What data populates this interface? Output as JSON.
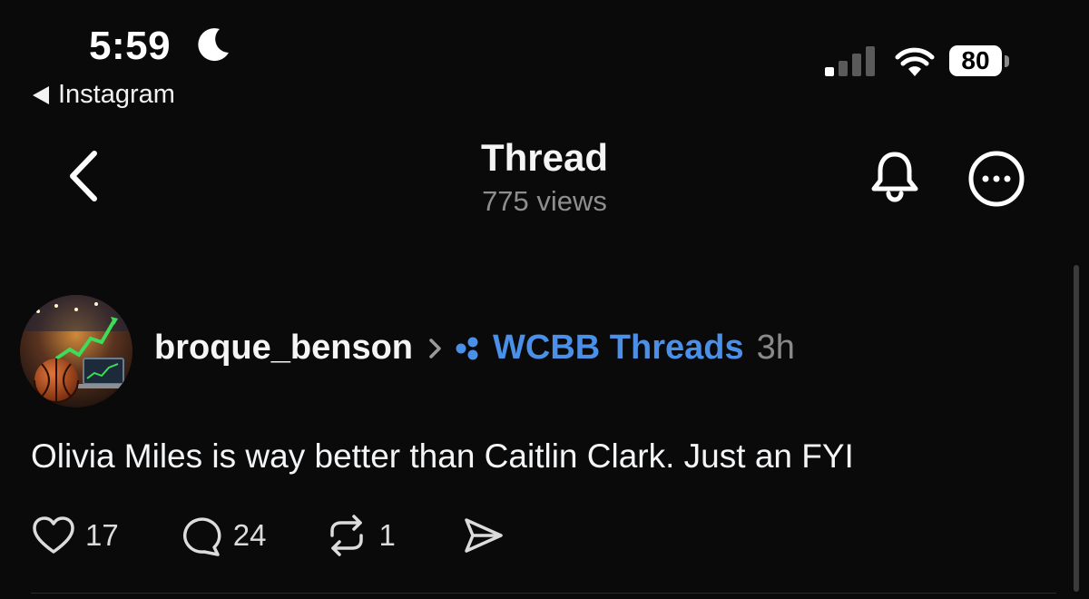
{
  "status_bar": {
    "time": "5:59",
    "back_app": "Instagram",
    "battery": "80"
  },
  "nav": {
    "title": "Thread",
    "views": "775 views"
  },
  "post": {
    "username": "broque_benson",
    "community": "WCBB Threads",
    "timestamp": "3h",
    "text": "Olivia Miles is way better than Caitlin Clark. Just an FYI",
    "likes": "17",
    "replies": "24",
    "reposts": "1"
  },
  "colors": {
    "background": "#0a0a0a",
    "community_link": "#4a8fe8",
    "secondary_text": "#8e8e8e"
  },
  "icons": [
    "moon-icon",
    "back-triangle-icon",
    "signal-icon",
    "wifi-icon",
    "battery-icon",
    "back-chevron-icon",
    "bell-icon",
    "more-icon",
    "chevron-right-icon",
    "community-icon",
    "heart-icon",
    "comment-icon",
    "repost-icon",
    "share-icon"
  ]
}
